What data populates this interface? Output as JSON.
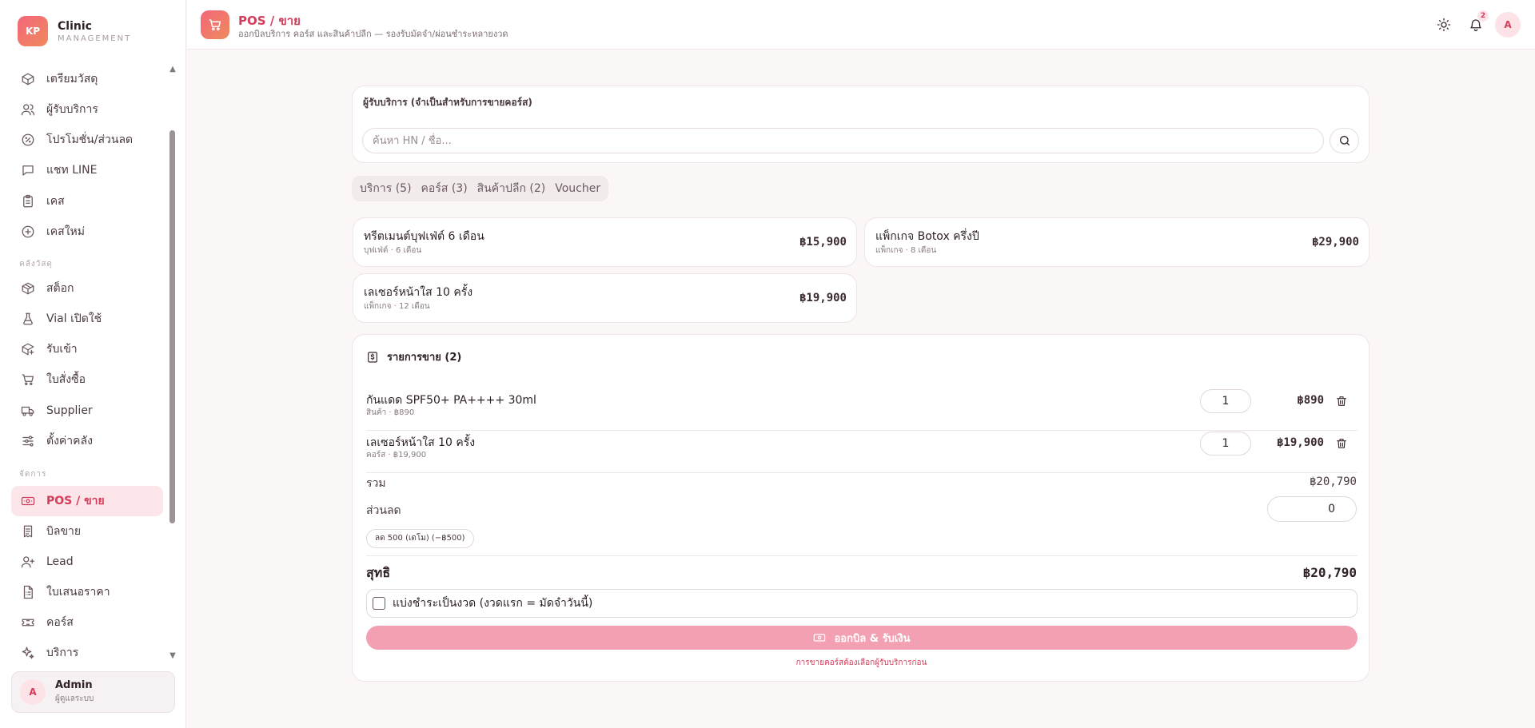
{
  "brand": {
    "logo": "KP",
    "name": "Clinic",
    "sub": "MANAGEMENT"
  },
  "sidebar": {
    "items_top": [
      {
        "label": "เตรียมวัสดุ",
        "icon": "package-check-icon"
      },
      {
        "label": "ผู้รับบริการ",
        "icon": "users-icon"
      },
      {
        "label": "โปรโมชั่น/ส่วนลด",
        "icon": "percent-icon"
      },
      {
        "label": "แชท LINE",
        "icon": "chat-icon"
      },
      {
        "label": "เคส",
        "icon": "clipboard-icon"
      },
      {
        "label": "เคสใหม่",
        "icon": "plus-circle-icon"
      }
    ],
    "section_stock": "คลังวัสดุ",
    "items_stock": [
      {
        "label": "สต็อก",
        "icon": "box-icon"
      },
      {
        "label": "Vial เปิดใช้",
        "icon": "flask-icon"
      },
      {
        "label": "รับเข้า",
        "icon": "package-in-icon"
      },
      {
        "label": "ใบสั่งซื้อ",
        "icon": "cart-icon"
      },
      {
        "label": "Supplier",
        "icon": "truck-icon"
      },
      {
        "label": "ตั้งค่าคลัง",
        "icon": "sliders-icon"
      }
    ],
    "section_manage": "จัดการ",
    "items_manage": [
      {
        "label": "POS / ขาย",
        "icon": "cash-icon",
        "active": true
      },
      {
        "label": "บิลขาย",
        "icon": "receipt-icon"
      },
      {
        "label": "Lead",
        "icon": "user-plus-icon"
      },
      {
        "label": "ใบเสนอราคา",
        "icon": "file-quote-icon"
      },
      {
        "label": "คอร์ส",
        "icon": "ticket-icon"
      },
      {
        "label": "บริการ",
        "icon": "sparkles-icon"
      }
    ]
  },
  "user": {
    "initial": "A",
    "name": "Admin",
    "role": "ผู้ดูแลระบบ"
  },
  "header": {
    "title": "POS / ขาย",
    "subtitle": "ออกบิลบริการ คอร์ส และสินค้าปลีก — รองรับมัดจำ/ผ่อนชำระหลายงวด",
    "notif_count": "2",
    "avatar": "A"
  },
  "customer": {
    "label": "ผู้รับบริการ (จำเป็นสำหรับการขายคอร์ส)",
    "placeholder": "ค้นหา HN / ชื่อ..."
  },
  "tabs": [
    "บริการ (5)",
    "คอร์ส (3)",
    "สินค้าปลีก (2)",
    "Voucher"
  ],
  "products": [
    {
      "name": "ทรีตเมนต์บุฟเฟ่ต์ 6 เดือน",
      "sub": "บุฟเฟ่ต์ · 6 เดือน",
      "price": "฿15,900"
    },
    {
      "name": "แพ็กเกจ Botox ครึ่งปี",
      "sub": "แพ็กเกจ · 8 เดือน",
      "price": "฿29,900"
    },
    {
      "name": "เลเซอร์หน้าใส 10 ครั้ง",
      "sub": "แพ็กเกจ · 12 เดือน",
      "price": "฿19,900"
    }
  ],
  "sale": {
    "title": "รายการขาย (2)",
    "lines": [
      {
        "name": "กันแดด SPF50+ PA++++ 30ml",
        "sub": "สินค้า · ฿890",
        "qty": "1",
        "total": "฿890"
      },
      {
        "name": "เลเซอร์หน้าใส 10 ครั้ง",
        "sub": "คอร์ส · ฿19,900",
        "qty": "1",
        "total": "฿19,900"
      }
    ],
    "subtotal_label": "รวม",
    "subtotal_value": "฿20,790",
    "discount_label": "ส่วนลด",
    "discount_value": "0",
    "discount_chip": "ลด 500 (เดโม) (−฿500)",
    "net_label": "สุทธิ",
    "net_value": "฿20,790",
    "installment_label": "แบ่งชำระเป็นงวด (งวดแรก = มัดจำวันนี้)",
    "submit_label": "ออกบิล & รับเงิน",
    "warning": "การขายคอร์สต้องเลือกผู้รับบริการก่อน"
  }
}
